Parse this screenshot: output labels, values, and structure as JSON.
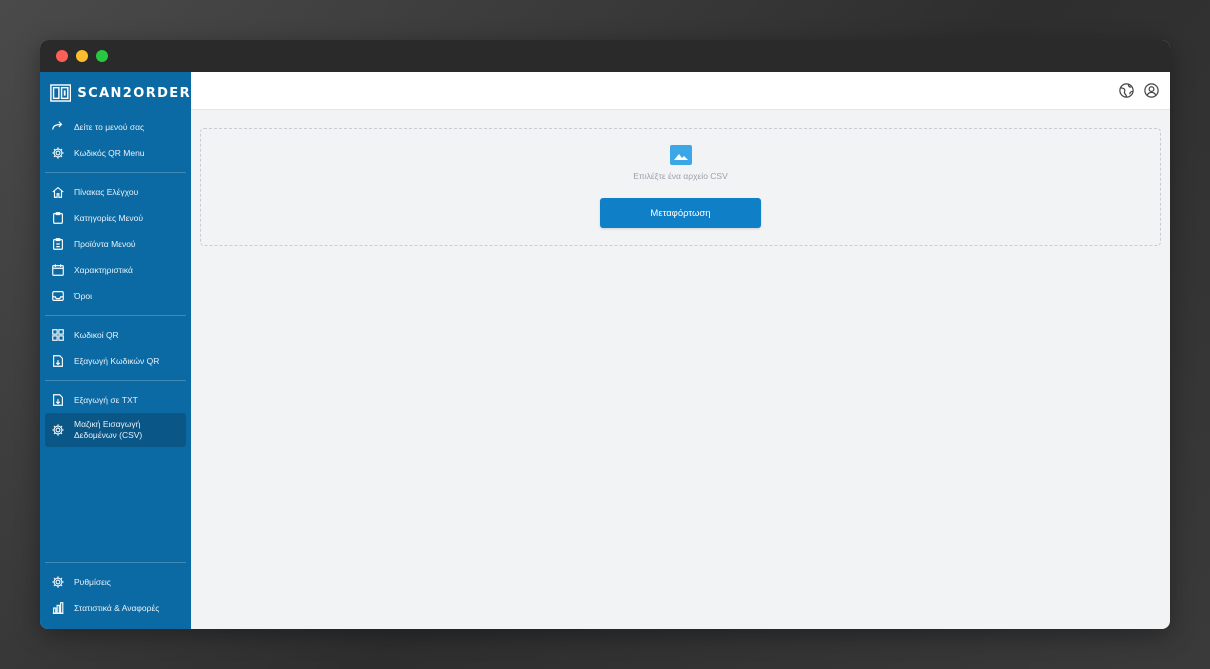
{
  "brand": {
    "name": "SCAN2ORDER"
  },
  "sidebar": {
    "group1": [
      {
        "label": "Δείτε το μενού σας",
        "icon": "share-arrow-icon"
      },
      {
        "label": "Κωδικός QR Menu",
        "icon": "gear-icon"
      }
    ],
    "group2": [
      {
        "label": "Πίνακας Ελέγχου",
        "icon": "home-icon"
      },
      {
        "label": "Κατηγορίες Μενού",
        "icon": "clipboard-icon"
      },
      {
        "label": "Προϊόντα Μενού",
        "icon": "clipboard-list-icon"
      },
      {
        "label": "Χαρακτηριστικά",
        "icon": "calendar-icon"
      },
      {
        "label": "Όροι",
        "icon": "inbox-icon"
      }
    ],
    "group3": [
      {
        "label": "Κωδικοί QR",
        "icon": "grid-icon"
      },
      {
        "label": "Εξαγωγή Κωδικών QR",
        "icon": "file-download-icon"
      }
    ],
    "group4": [
      {
        "label": "Εξαγωγή σε TXT",
        "icon": "file-download-icon"
      },
      {
        "label": "Μαζική Εισαγωγή\nΔεδομένων (CSV)",
        "icon": "gear-icon",
        "active": true
      }
    ],
    "bottom": [
      {
        "label": "Ρυθμίσεις",
        "icon": "gear-icon"
      },
      {
        "label": "Στατιστικά & Αναφορές",
        "icon": "bar-chart-icon"
      }
    ]
  },
  "topbar": {
    "icons": [
      "globe-icon",
      "user-circle-icon"
    ]
  },
  "upload": {
    "hint": "Επιλέξτε ένα αρχείο CSV",
    "button_label": "Μεταφόρτωση"
  },
  "colors": {
    "sidebar": "#0b6aa3",
    "sidebar_active": "#0a5686",
    "button": "#0f7fc7",
    "image_icon": "#3ba7e6"
  }
}
